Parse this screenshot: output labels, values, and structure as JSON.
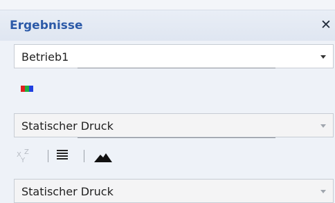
{
  "panel": {
    "title": "Ergebnisse",
    "close_glyph": "✕"
  },
  "combos": {
    "operation": "Betrieb1",
    "result_type_1": "Statischer Druck",
    "result_type_2": "Statischer Druck"
  },
  "toolbar": {
    "axes_icon": {
      "x": "X",
      "y": "Y",
      "z": "Z"
    }
  },
  "icons": [
    "color-legend-icon",
    "xyz-axes-icon",
    "list-icon",
    "mountain-icon"
  ],
  "colors": {
    "title_text": "#2c5aa8",
    "legend_red": "#e02020",
    "legend_green": "#20b040",
    "legend_blue": "#2040e0"
  }
}
